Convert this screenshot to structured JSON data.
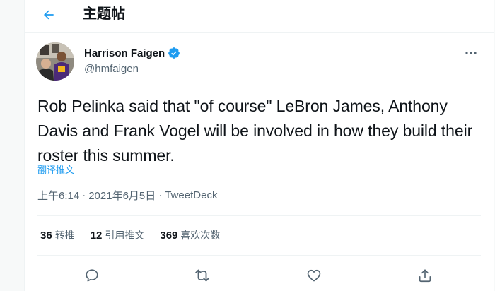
{
  "header": {
    "title": "主题帖"
  },
  "author": {
    "name": "Harrison Faigen",
    "handle": "@hmfaigen",
    "verified": true
  },
  "tweet": {
    "text": "Rob Pelinka said that \"of course\" LeBron James, Anthony Davis and Frank Vogel will be involved in how they build their roster this summer.",
    "translate_label": "翻译推文"
  },
  "meta": {
    "time": "上午6:14",
    "separator": "·",
    "date": "2021年6月5日",
    "source": "TweetDeck"
  },
  "stats": [
    {
      "count": "36",
      "label": "转推"
    },
    {
      "count": "12",
      "label": "引用推文"
    },
    {
      "count": "369",
      "label": "喜欢次数"
    }
  ],
  "icons": {
    "back": "arrow-left-icon",
    "verified": "verified-badge-icon",
    "more": "more-horizontal-icon",
    "reply": "reply-icon",
    "retweet": "retweet-icon",
    "like": "like-icon",
    "share": "share-icon"
  },
  "colors": {
    "accent": "#1d9bf0",
    "text": "#0f1419",
    "secondary": "#536471"
  }
}
